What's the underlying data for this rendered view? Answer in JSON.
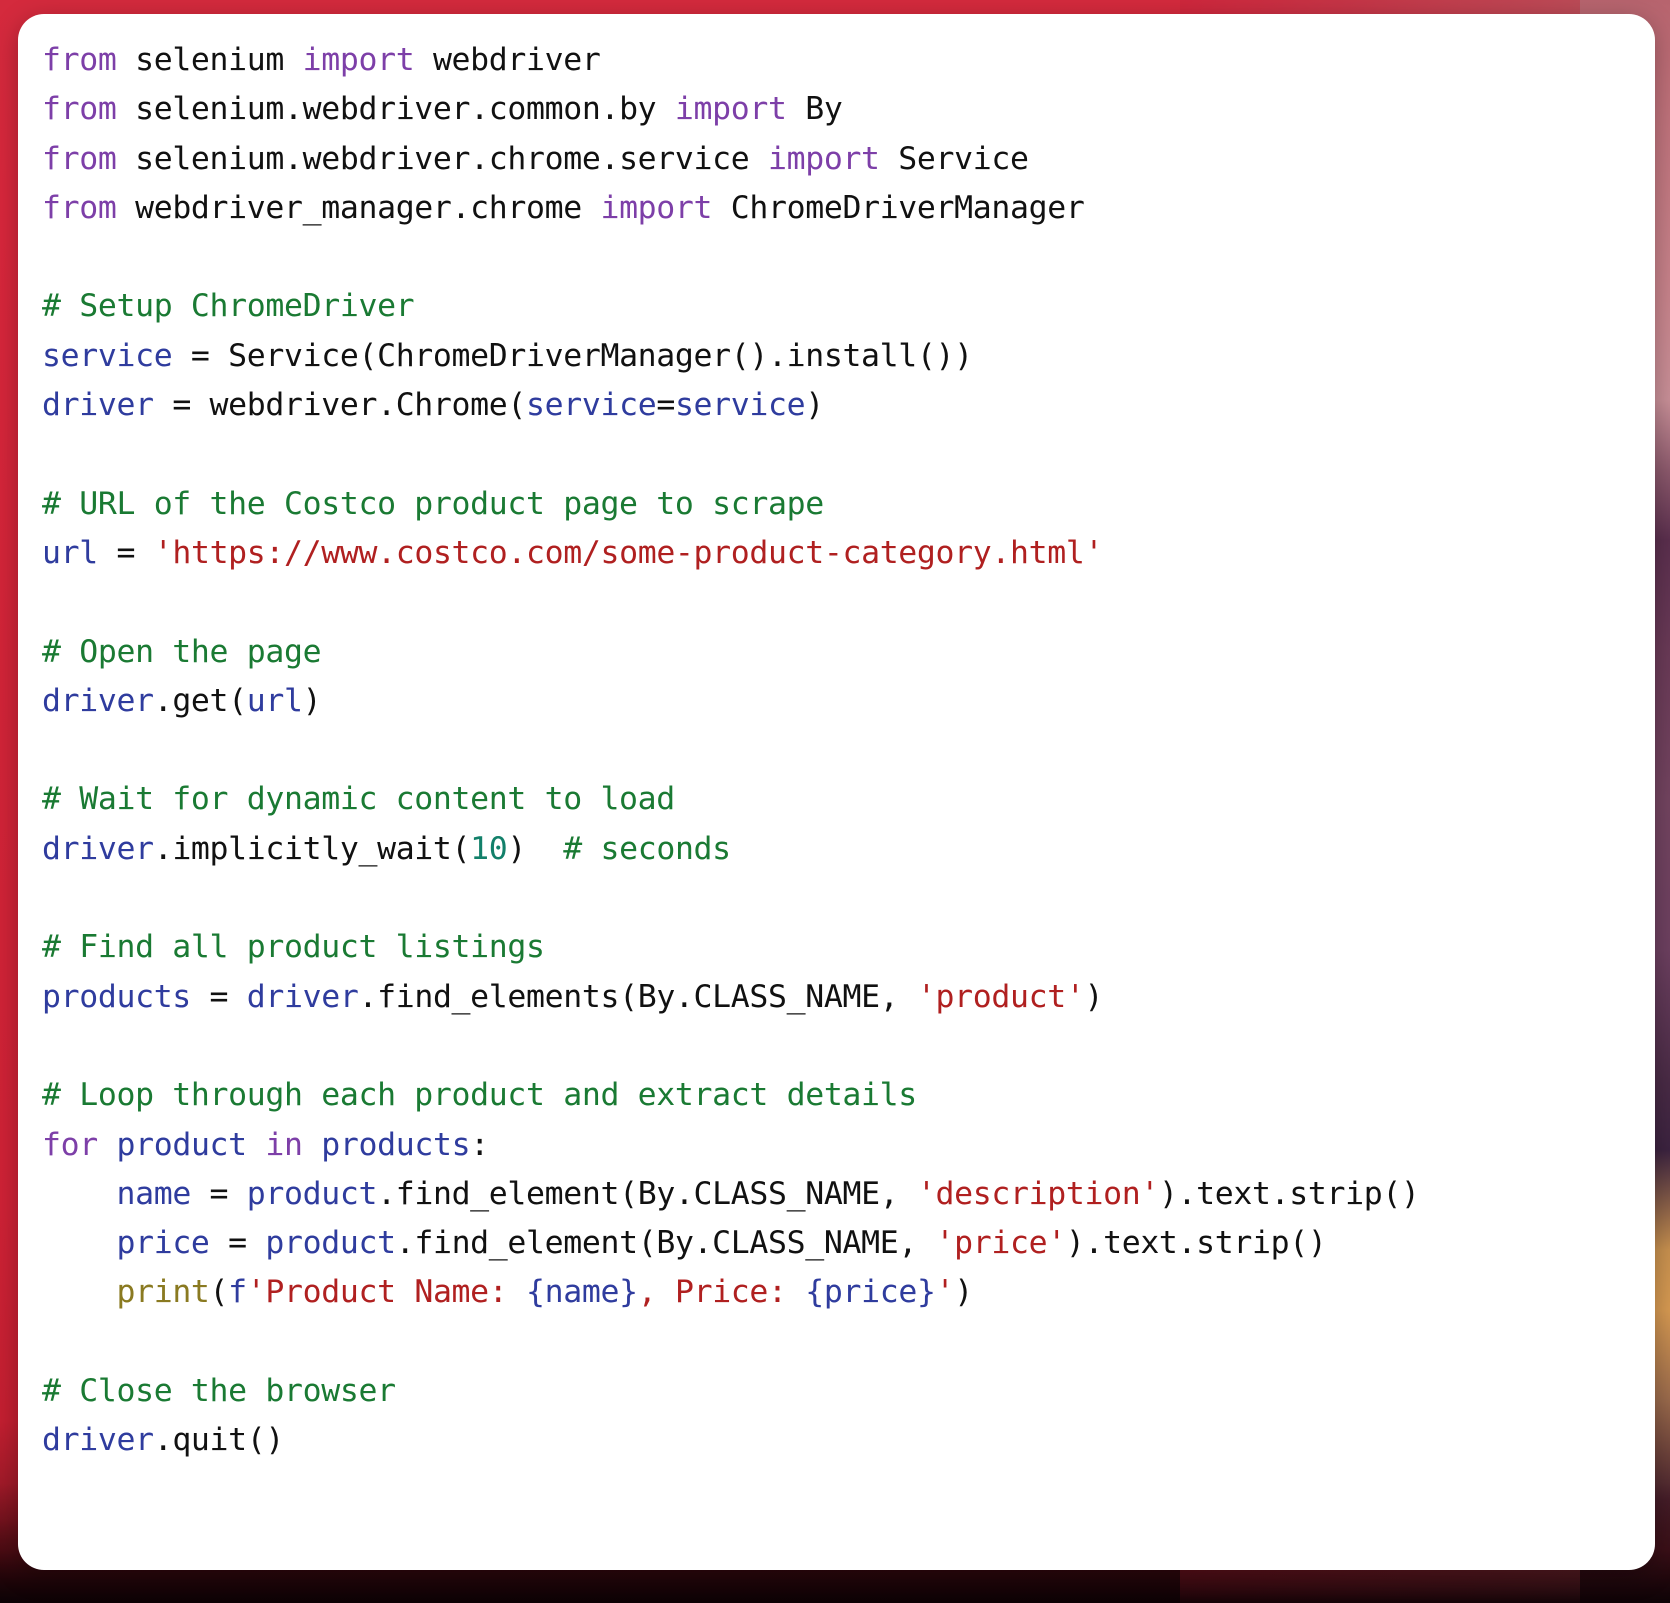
{
  "card": {
    "language": "python",
    "background_color": "#ffffff",
    "page_background_color": "#d42a3d"
  },
  "colors": {
    "keyword": "#7d3fa8",
    "comment": "#1a7a33",
    "string": "#b02020",
    "variable": "#2f3c9e",
    "number": "#12806a",
    "builtin": "#8a7a21",
    "plain": "#111111"
  },
  "code": {
    "lines": [
      {
        "id": 1,
        "tokens": [
          {
            "t": "from",
            "c": "kw"
          },
          {
            "t": " selenium ",
            "c": "pln"
          },
          {
            "t": "import",
            "c": "kw"
          },
          {
            "t": " webdriver",
            "c": "pln"
          }
        ]
      },
      {
        "id": 2,
        "tokens": [
          {
            "t": "from",
            "c": "kw"
          },
          {
            "t": " selenium.webdriver.common.by ",
            "c": "pln"
          },
          {
            "t": "import",
            "c": "kw"
          },
          {
            "t": " By",
            "c": "pln"
          }
        ]
      },
      {
        "id": 3,
        "tokens": [
          {
            "t": "from",
            "c": "kw"
          },
          {
            "t": " selenium.webdriver.chrome.service ",
            "c": "pln"
          },
          {
            "t": "import",
            "c": "kw"
          },
          {
            "t": " Service",
            "c": "pln"
          }
        ]
      },
      {
        "id": 4,
        "tokens": [
          {
            "t": "from",
            "c": "kw"
          },
          {
            "t": " webdriver_manager.chrome ",
            "c": "pln"
          },
          {
            "t": "import",
            "c": "kw"
          },
          {
            "t": " ChromeDriverManager",
            "c": "pln"
          }
        ]
      },
      {
        "id": 5,
        "tokens": []
      },
      {
        "id": 6,
        "tokens": [
          {
            "t": "# Setup ChromeDriver",
            "c": "cmt"
          }
        ]
      },
      {
        "id": 7,
        "tokens": [
          {
            "t": "service",
            "c": "var"
          },
          {
            "t": " = Service(ChromeDriverManager().install())",
            "c": "pln"
          }
        ]
      },
      {
        "id": 8,
        "tokens": [
          {
            "t": "driver",
            "c": "var"
          },
          {
            "t": " = webdriver.Chrome(",
            "c": "pln"
          },
          {
            "t": "service",
            "c": "var"
          },
          {
            "t": "=",
            "c": "pln"
          },
          {
            "t": "service",
            "c": "var"
          },
          {
            "t": ")",
            "c": "pln"
          }
        ]
      },
      {
        "id": 9,
        "tokens": []
      },
      {
        "id": 10,
        "tokens": [
          {
            "t": "# URL of the Costco product page to scrape",
            "c": "cmt"
          }
        ]
      },
      {
        "id": 11,
        "tokens": [
          {
            "t": "url",
            "c": "var"
          },
          {
            "t": " = ",
            "c": "pln"
          },
          {
            "t": "'https://www.costco.com/some-product-category.html'",
            "c": "str"
          }
        ]
      },
      {
        "id": 12,
        "tokens": []
      },
      {
        "id": 13,
        "tokens": [
          {
            "t": "# Open the page",
            "c": "cmt"
          }
        ]
      },
      {
        "id": 14,
        "tokens": [
          {
            "t": "driver",
            "c": "var"
          },
          {
            "t": ".get(",
            "c": "pln"
          },
          {
            "t": "url",
            "c": "var"
          },
          {
            "t": ")",
            "c": "pln"
          }
        ]
      },
      {
        "id": 15,
        "tokens": []
      },
      {
        "id": 16,
        "tokens": [
          {
            "t": "# Wait for dynamic content to load",
            "c": "cmt"
          }
        ]
      },
      {
        "id": 17,
        "tokens": [
          {
            "t": "driver",
            "c": "var"
          },
          {
            "t": ".implicitly_wait(",
            "c": "pln"
          },
          {
            "t": "10",
            "c": "num"
          },
          {
            "t": ")  ",
            "c": "pln"
          },
          {
            "t": "# seconds",
            "c": "cmt"
          }
        ]
      },
      {
        "id": 18,
        "tokens": []
      },
      {
        "id": 19,
        "tokens": [
          {
            "t": "# Find all product listings",
            "c": "cmt"
          }
        ]
      },
      {
        "id": 20,
        "tokens": [
          {
            "t": "products",
            "c": "var"
          },
          {
            "t": " = ",
            "c": "pln"
          },
          {
            "t": "driver",
            "c": "var"
          },
          {
            "t": ".find_elements(By.CLASS_NAME, ",
            "c": "pln"
          },
          {
            "t": "'product'",
            "c": "str"
          },
          {
            "t": ")",
            "c": "pln"
          }
        ]
      },
      {
        "id": 21,
        "tokens": []
      },
      {
        "id": 22,
        "tokens": [
          {
            "t": "# Loop through each product and extract details",
            "c": "cmt"
          }
        ]
      },
      {
        "id": 23,
        "tokens": [
          {
            "t": "for",
            "c": "kw"
          },
          {
            "t": " ",
            "c": "pln"
          },
          {
            "t": "product",
            "c": "var"
          },
          {
            "t": " ",
            "c": "pln"
          },
          {
            "t": "in",
            "c": "kw"
          },
          {
            "t": " ",
            "c": "pln"
          },
          {
            "t": "products",
            "c": "var"
          },
          {
            "t": ":",
            "c": "pln"
          }
        ]
      },
      {
        "id": 24,
        "tokens": [
          {
            "t": "    ",
            "c": "pln"
          },
          {
            "t": "name",
            "c": "var"
          },
          {
            "t": " = ",
            "c": "pln"
          },
          {
            "t": "product",
            "c": "var"
          },
          {
            "t": ".find_element(By.CLASS_NAME, ",
            "c": "pln"
          },
          {
            "t": "'description'",
            "c": "str"
          },
          {
            "t": ").text.strip()",
            "c": "pln"
          }
        ]
      },
      {
        "id": 25,
        "tokens": [
          {
            "t": "    ",
            "c": "pln"
          },
          {
            "t": "price",
            "c": "var"
          },
          {
            "t": " = ",
            "c": "pln"
          },
          {
            "t": "product",
            "c": "var"
          },
          {
            "t": ".find_element(By.CLASS_NAME, ",
            "c": "pln"
          },
          {
            "t": "'price'",
            "c": "str"
          },
          {
            "t": ").text.strip()",
            "c": "pln"
          }
        ]
      },
      {
        "id": 26,
        "tokens": [
          {
            "t": "    ",
            "c": "pln"
          },
          {
            "t": "print",
            "c": "bi"
          },
          {
            "t": "(",
            "c": "pln"
          },
          {
            "t": "f",
            "c": "fpfx"
          },
          {
            "t": "'Product Name: ",
            "c": "str"
          },
          {
            "t": "{name}",
            "c": "fld"
          },
          {
            "t": ", Price: ",
            "c": "str"
          },
          {
            "t": "{price}",
            "c": "fld"
          },
          {
            "t": "'",
            "c": "str"
          },
          {
            "t": ")",
            "c": "pln"
          }
        ]
      },
      {
        "id": 27,
        "tokens": []
      },
      {
        "id": 28,
        "tokens": [
          {
            "t": "# Close the browser",
            "c": "cmt"
          }
        ]
      },
      {
        "id": 29,
        "tokens": [
          {
            "t": "driver",
            "c": "var"
          },
          {
            "t": ".quit()",
            "c": "pln"
          }
        ]
      }
    ],
    "plain_text": "from selenium import webdriver\nfrom selenium.webdriver.common.by import By\nfrom selenium.webdriver.chrome.service import Service\nfrom webdriver_manager.chrome import ChromeDriverManager\n\n# Setup ChromeDriver\nservice = Service(ChromeDriverManager().install())\ndriver = webdriver.Chrome(service=service)\n\n# URL of the Costco product page to scrape\nurl = 'https://www.costco.com/some-product-category.html'\n\n# Open the page\ndriver.get(url)\n\n# Wait for dynamic content to load\ndriver.implicitly_wait(10)  # seconds\n\n# Find all product listings\nproducts = driver.find_elements(By.CLASS_NAME, 'product')\n\n# Loop through each product and extract details\nfor product in products:\n    name = product.find_element(By.CLASS_NAME, 'description').text.strip()\n    price = product.find_element(By.CLASS_NAME, 'price').text.strip()\n    print(f'Product Name: {name}, Price: {price}')\n\n# Close the browser\ndriver.quit()"
  }
}
